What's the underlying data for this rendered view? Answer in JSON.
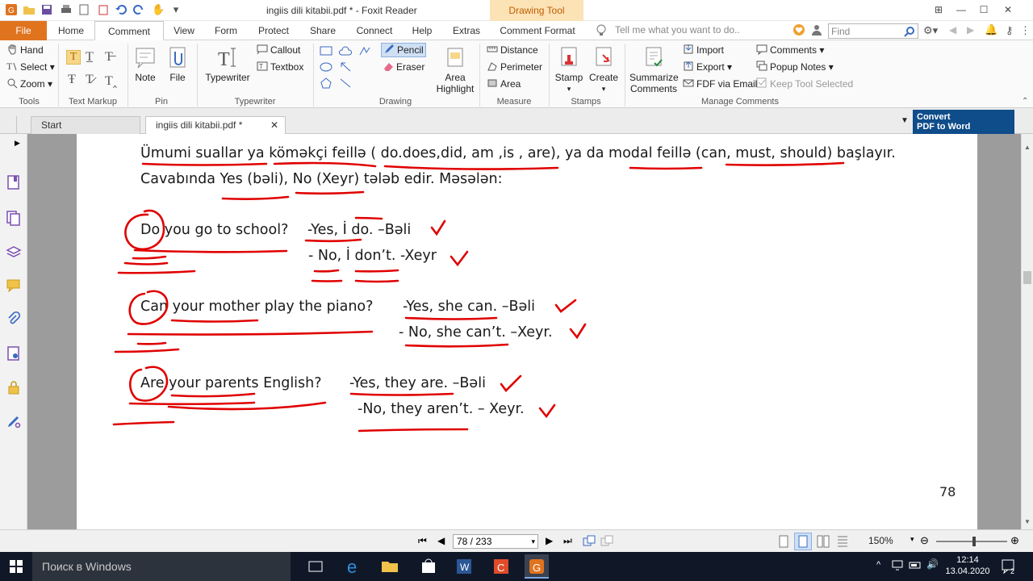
{
  "titlebar": {
    "title": "ingiis dili kitabii.pdf * - Foxit Reader",
    "context_tab": "Drawing Tool"
  },
  "tabs": {
    "file": "File",
    "items": [
      "Home",
      "Comment",
      "View",
      "Form",
      "Protect",
      "Share",
      "Connect",
      "Help",
      "Extras",
      "Comment Format"
    ],
    "active": "Comment",
    "tell_me": "Tell me what you want to do..",
    "find_placeholder": "Find"
  },
  "ribbon": {
    "tools": {
      "hand": "Hand",
      "select": "Select",
      "zoom": "Zoom",
      "label": "Tools"
    },
    "text_markup": {
      "label": "Text Markup"
    },
    "pin": {
      "note": "Note",
      "file": "File",
      "label": "Pin"
    },
    "typewriter": {
      "typewriter": "Typewriter",
      "callout": "Callout",
      "textbox": "Textbox",
      "label": "Typewriter"
    },
    "drawing": {
      "pencil": "Pencil",
      "eraser": "Eraser",
      "area_highlight_1": "Area",
      "area_highlight_2": "Highlight",
      "label": "Drawing"
    },
    "measure": {
      "distance": "Distance",
      "perimeter": "Perimeter",
      "area": "Area",
      "label": "Measure"
    },
    "stamps": {
      "stamp": "Stamp",
      "create": "Create",
      "label": "Stamps"
    },
    "manage": {
      "summarize_1": "Summarize",
      "summarize_2": "Comments",
      "import": "Import",
      "export": "Export",
      "fdf_email": "FDF via Email",
      "comments": "Comments",
      "popup_notes": "Popup Notes",
      "keep_tool": "Keep Tool Selected",
      "label": "Manage Comments"
    }
  },
  "doc_tabs": {
    "start": "Start",
    "current": "ingiis dili kitabii.pdf *",
    "convert_1": "Convert",
    "convert_2": "PDF to Word"
  },
  "document": {
    "line1": "Ümumi suallar ya köməkçi feillə ( do.does,did, am ,is , are), ya  da modal feillə (can, must, should) başlayır.",
    "line2": "Cavabında Yes (bəli), No (Xeyr) tələb edir. Məsələn:",
    "q1": "Do you go to school?",
    "a1_yes": "-Yes, İ do. –Bəli",
    "a1_no": "- No, İ don’t. -Xeyr",
    "q2": "Can your mother play the piano?",
    "a2_yes": "-Yes, she can. –Bəli",
    "a2_no": "- No, she can’t. –Xeyr.",
    "q3": "Are your parents English?",
    "a3_yes": "-Yes, they are. –Bəli",
    "a3_no": "-No, they aren’t. – Xeyr.",
    "page_number": "78"
  },
  "statusbar": {
    "page_indicator": "78 / 233",
    "zoom": "150%"
  },
  "taskbar": {
    "search": "Поиск в Windows",
    "time": "12:14",
    "date": "13.04.2020",
    "notifications": "2"
  },
  "colors": {
    "file_tab": "#e0731e",
    "context_tab_bg": "#fbe3b6",
    "annotation_red": "#e00000",
    "taskbar": "#101828",
    "convert_bg": "#0f4c8a"
  }
}
